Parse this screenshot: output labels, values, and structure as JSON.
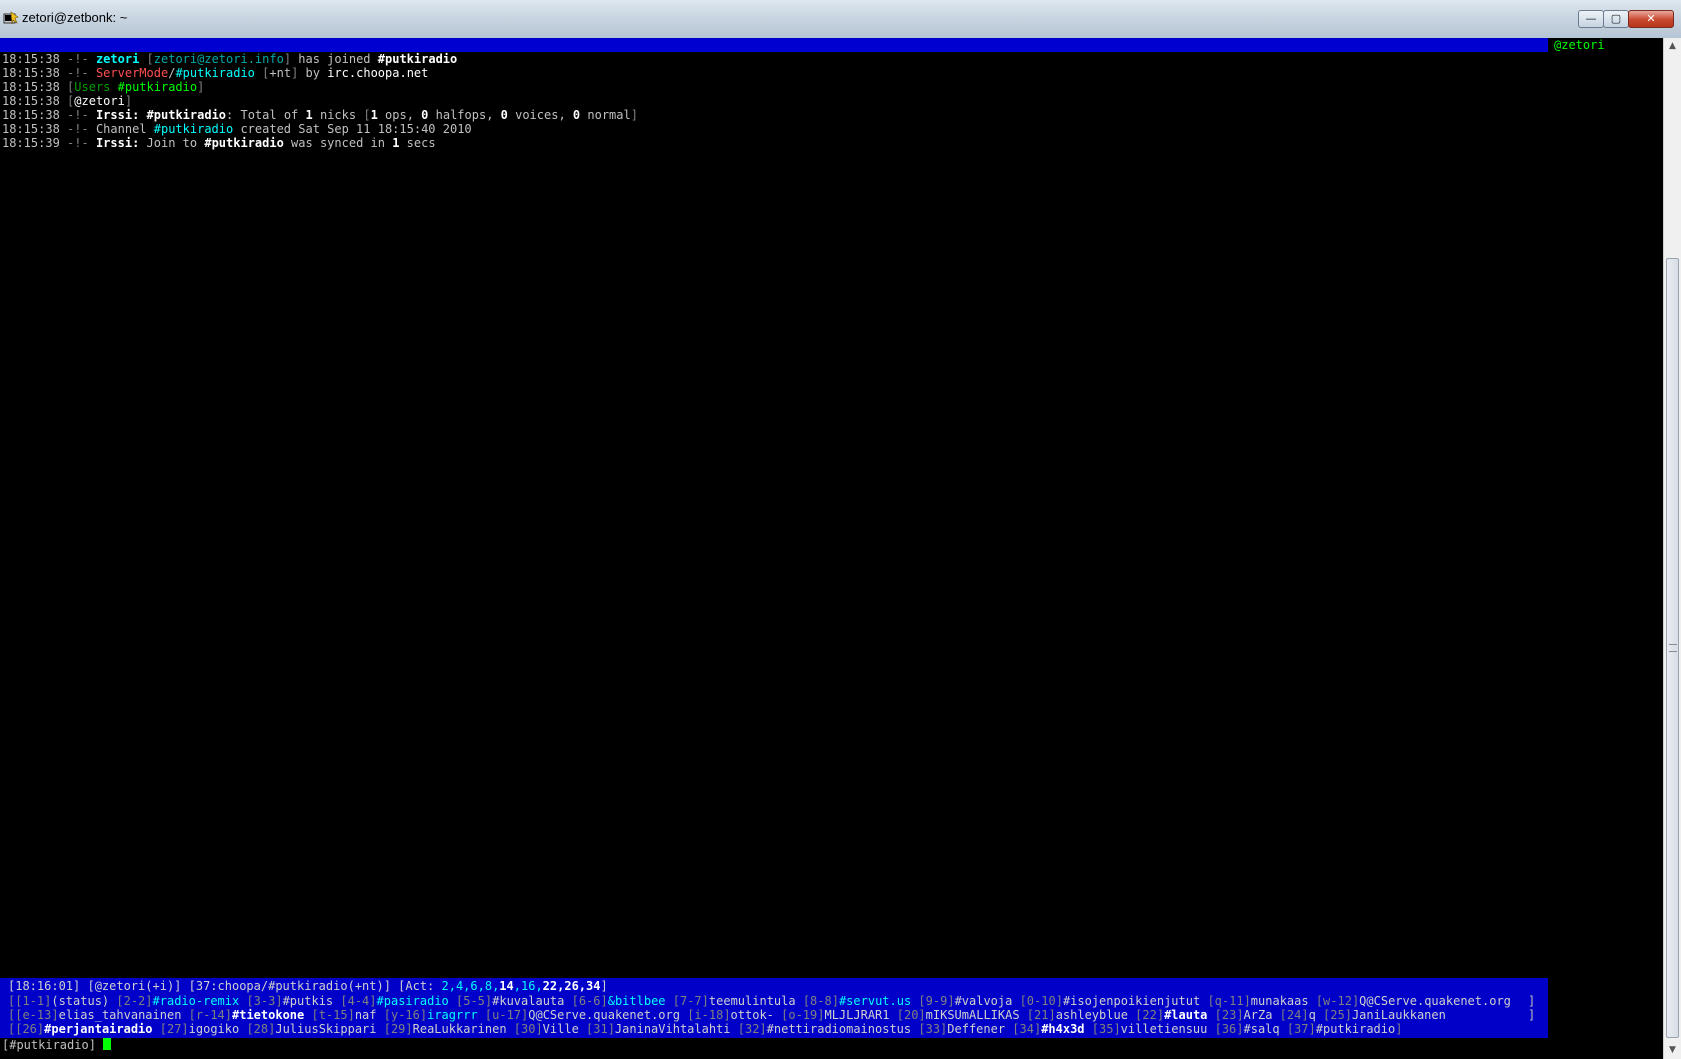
{
  "window": {
    "title": "zetori@zetbonk: ~",
    "minimize": "—",
    "maximize": "▢",
    "close": "✕"
  },
  "nicklist": {
    "nicks": [
      "@zetori"
    ]
  },
  "messages": [
    {
      "time": "18:15:38",
      "prefix": "-!-",
      "parts": [
        {
          "t": " "
        },
        {
          "t": "zetori",
          "cls": "b c"
        },
        {
          "t": " "
        },
        {
          "t": "[",
          "cls": "gr"
        },
        {
          "t": "zetori@zetori.info",
          "cls": "cd"
        },
        {
          "t": "]",
          "cls": "gr"
        },
        {
          "t": " has joined "
        },
        {
          "t": "#putkiradio",
          "cls": "b"
        }
      ]
    },
    {
      "time": "18:15:38",
      "prefix": "-!-",
      "parts": [
        {
          "t": " "
        },
        {
          "t": "ServerMode",
          "cls": "r"
        },
        {
          "t": "/"
        },
        {
          "t": "#putkiradio",
          "cls": "c"
        },
        {
          "t": " "
        },
        {
          "t": "[",
          "cls": "gr"
        },
        {
          "t": "+nt"
        },
        {
          "t": "]",
          "cls": "gr"
        },
        {
          "t": " by "
        },
        {
          "t": "irc.choopa.net",
          "cls": "w"
        }
      ]
    },
    {
      "time": "18:15:38",
      "prefix": "",
      "parts": [
        {
          "t": "[",
          "cls": "gr"
        },
        {
          "t": "Users ",
          "cls": "gd"
        },
        {
          "t": "#putkiradio",
          "cls": "g"
        },
        {
          "t": "]",
          "cls": "gr"
        }
      ]
    },
    {
      "time": "18:15:38",
      "prefix": "",
      "parts": [
        {
          "t": "[",
          "cls": "gr"
        },
        {
          "t": "@zetori",
          "cls": "w"
        },
        {
          "t": "]",
          "cls": "gr"
        }
      ]
    },
    {
      "time": "18:15:38",
      "prefix": "-!-",
      "parts": [
        {
          "t": " "
        },
        {
          "t": "Irssi:",
          "cls": "b"
        },
        {
          "t": " "
        },
        {
          "t": "#putkiradio",
          "cls": "b"
        },
        {
          "t": ": Total of "
        },
        {
          "t": "1",
          "cls": "b"
        },
        {
          "t": " nicks "
        },
        {
          "t": "[",
          "cls": "gr"
        },
        {
          "t": "1",
          "cls": "b"
        },
        {
          "t": " ops, "
        },
        {
          "t": "0",
          "cls": "b"
        },
        {
          "t": " halfops, "
        },
        {
          "t": "0",
          "cls": "b"
        },
        {
          "t": " voices, "
        },
        {
          "t": "0",
          "cls": "b"
        },
        {
          "t": " normal"
        },
        {
          "t": "]",
          "cls": "gr"
        }
      ]
    },
    {
      "time": "18:15:38",
      "prefix": "-!-",
      "parts": [
        {
          "t": " Channel "
        },
        {
          "t": "#putkiradio",
          "cls": "c"
        },
        {
          "t": " created Sat Sep 11 18:15:40 2010"
        }
      ]
    },
    {
      "time": "18:15:39",
      "prefix": "-!-",
      "parts": [
        {
          "t": " "
        },
        {
          "t": "Irssi:",
          "cls": "b"
        },
        {
          "t": " Join to "
        },
        {
          "t": "#putkiradio",
          "cls": "b"
        },
        {
          "t": " was synced in "
        },
        {
          "t": "1",
          "cls": "b"
        },
        {
          "t": " secs"
        }
      ]
    }
  ],
  "statusbar": {
    "line1": [
      {
        "t": "[18:16:01]"
      },
      {
        "t": " [@zetori(+i)]"
      },
      {
        "t": " [37:choopa/#putkiradio(+nt)]"
      },
      {
        "t": " [Act: "
      },
      {
        "t": "2,4,6,8,",
        "cls": "c"
      },
      {
        "t": "14",
        "cls": "b"
      },
      {
        "t": ",",
        "cls": "c"
      },
      {
        "t": "16",
        "cls": "c"
      },
      {
        "t": ",",
        "cls": "c"
      },
      {
        "t": "22,26,34",
        "cls": "b"
      },
      {
        "t": "]"
      }
    ],
    "line2": [
      {
        "t": "[",
        "cls": "gr"
      },
      {
        "t": "[1-1]",
        "cls": "gr"
      },
      {
        "t": "(status)"
      },
      {
        "t": " [2-2]",
        "cls": "gr"
      },
      {
        "t": "#radio-remix",
        "cls": "c"
      },
      {
        "t": " [3-3]",
        "cls": "gr"
      },
      {
        "t": "#putkis"
      },
      {
        "t": " [4-4]",
        "cls": "gr"
      },
      {
        "t": "#pasiradio",
        "cls": "c"
      },
      {
        "t": " [5-5]",
        "cls": "gr"
      },
      {
        "t": "#kuvalauta"
      },
      {
        "t": " [6-6]",
        "cls": "gr"
      },
      {
        "t": "&bitlbee",
        "cls": "c"
      },
      {
        "t": " [7-7]",
        "cls": "gr"
      },
      {
        "t": "teemulintula"
      },
      {
        "t": " [8-8]",
        "cls": "gr"
      },
      {
        "t": "#servut.us",
        "cls": "c"
      },
      {
        "t": " [9-9]",
        "cls": "gr"
      },
      {
        "t": "#valvoja"
      },
      {
        "t": " [0-10]",
        "cls": "gr"
      },
      {
        "t": "#isojenpoikienjutut"
      },
      {
        "t": " [q-11]",
        "cls": "gr"
      },
      {
        "t": "munakaas"
      },
      {
        "t": " [w-12]",
        "cls": "gr"
      },
      {
        "t": "Q@CServe.quakenet.org"
      }
    ],
    "line3": [
      {
        "t": "[",
        "cls": "gr"
      },
      {
        "t": "[e-13]",
        "cls": "gr"
      },
      {
        "t": "elias_tahvanainen"
      },
      {
        "t": " [r-14]",
        "cls": "gr"
      },
      {
        "t": "#tietokone",
        "cls": "b"
      },
      {
        "t": " [t-15]",
        "cls": "gr"
      },
      {
        "t": "naf"
      },
      {
        "t": " [y-16]",
        "cls": "gr"
      },
      {
        "t": "iragrrr",
        "cls": "c"
      },
      {
        "t": " [u-17]",
        "cls": "gr"
      },
      {
        "t": "Q@CServe.quakenet.org"
      },
      {
        "t": " [i-18]",
        "cls": "gr"
      },
      {
        "t": "ottok-"
      },
      {
        "t": " [o-19]",
        "cls": "gr"
      },
      {
        "t": "MLJLJRAR1"
      },
      {
        "t": " [20]",
        "cls": "gr"
      },
      {
        "t": "mIKSUmALLIKAS"
      },
      {
        "t": " [21]",
        "cls": "gr"
      },
      {
        "t": "ashleyblue"
      },
      {
        "t": " [22]",
        "cls": "gr"
      },
      {
        "t": "#lauta",
        "cls": "b"
      },
      {
        "t": " [23]",
        "cls": "gr"
      },
      {
        "t": "ArZa"
      },
      {
        "t": " [24]",
        "cls": "gr"
      },
      {
        "t": "q"
      },
      {
        "t": " [25]",
        "cls": "gr"
      },
      {
        "t": "JaniLaukkanen"
      }
    ],
    "line4": [
      {
        "t": "[",
        "cls": "gr"
      },
      {
        "t": "[26]",
        "cls": "gr"
      },
      {
        "t": "#perjantairadio",
        "cls": "b"
      },
      {
        "t": " [27]",
        "cls": "gr"
      },
      {
        "t": "igogiko"
      },
      {
        "t": " [28]",
        "cls": "gr"
      },
      {
        "t": "JuliusSkippari"
      },
      {
        "t": " [29]",
        "cls": "gr"
      },
      {
        "t": "ReaLukkarinen"
      },
      {
        "t": " [30]",
        "cls": "gr"
      },
      {
        "t": "Ville"
      },
      {
        "t": " [31]",
        "cls": "gr"
      },
      {
        "t": "JaninaVihtalahti"
      },
      {
        "t": " [32]",
        "cls": "gr"
      },
      {
        "t": "#nettiradiomainostus"
      },
      {
        "t": " [33]",
        "cls": "gr"
      },
      {
        "t": "Deffener"
      },
      {
        "t": " [34]",
        "cls": "gr"
      },
      {
        "t": "#h4x3d",
        "cls": "b"
      },
      {
        "t": " [35]",
        "cls": "gr"
      },
      {
        "t": "villetiensuu"
      },
      {
        "t": " [36]",
        "cls": "gr"
      },
      {
        "t": "#salq"
      },
      {
        "t": " [37]",
        "cls": "gr"
      },
      {
        "t": "#putkiradio"
      },
      {
        "t": "]",
        "cls": "gr"
      }
    ],
    "right_bracket": "]"
  },
  "prompt": {
    "text": "[#putkiradio] "
  },
  "scrollbar": {
    "up": "▲",
    "down": "▼"
  }
}
